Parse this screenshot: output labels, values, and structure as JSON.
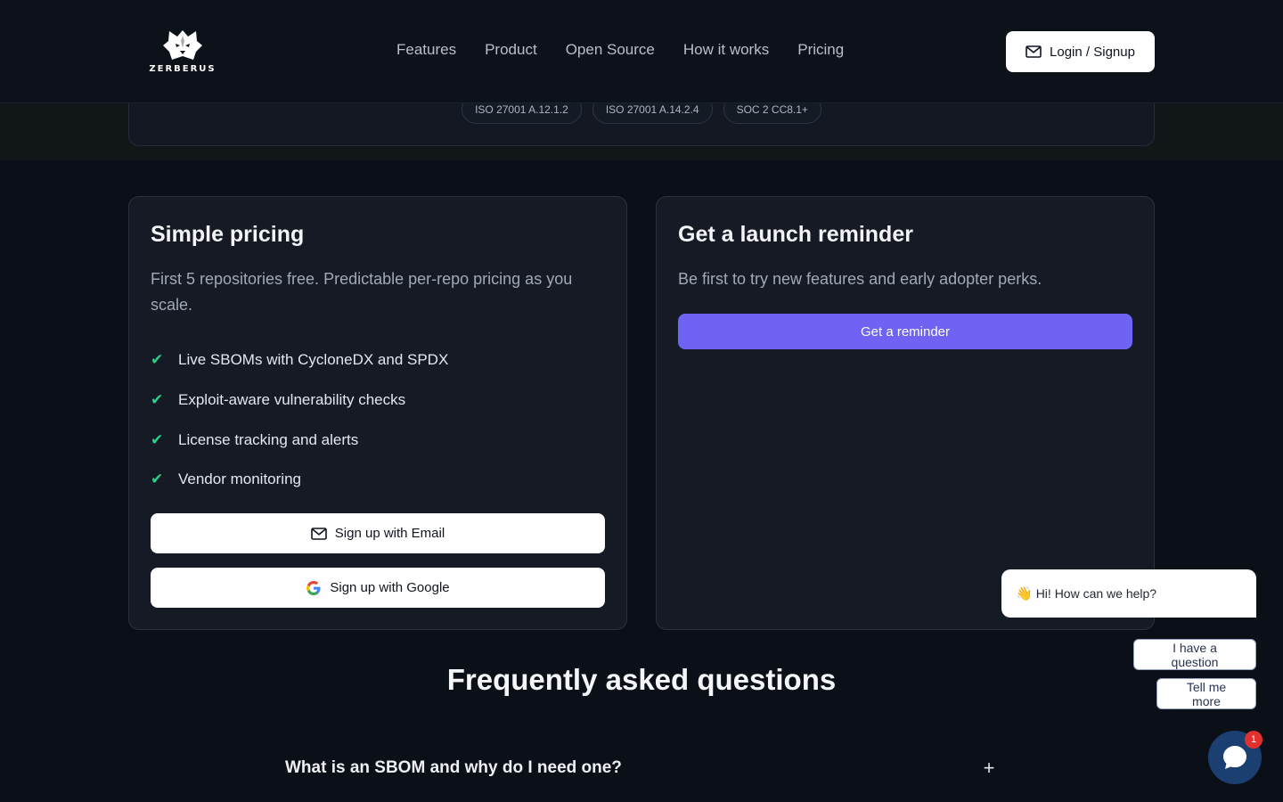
{
  "header": {
    "logo_text": "ZERBERUS",
    "nav": [
      "Features",
      "Product",
      "Open Source",
      "How it works",
      "Pricing"
    ],
    "login_label": "Login / Signup"
  },
  "compliance_chips": [
    "ISO 27001 A.12.1.2",
    "ISO 27001 A.14.2.4",
    "SOC 2 CC8.1+"
  ],
  "pricing": {
    "title": "Simple pricing",
    "description": "First 5 repositories free. Predictable per-repo pricing as you scale.",
    "features": [
      "Live SBOMs with CycloneDX and SPDX",
      "Exploit-aware vulnerability checks",
      "License tracking and alerts",
      "Vendor monitoring"
    ],
    "email_signup_label": "Sign up with Email",
    "google_signup_label": "Sign up with Google"
  },
  "reminder": {
    "title": "Get a launch reminder",
    "description": "Be first to try new features and early adopter perks.",
    "button_label": "Get a reminder"
  },
  "faq": {
    "title": "Frequently asked questions",
    "items": [
      {
        "question": "What is an SBOM and why do I need one?",
        "toggle": "+"
      }
    ]
  },
  "chat": {
    "greeting_emoji": "👋",
    "greeting": "Hi! How can we help?",
    "quick_replies": [
      "I have a question",
      "Tell me more"
    ],
    "unread_count": "1"
  },
  "colors": {
    "accent": "#6e63f2",
    "check": "#2ecf8a",
    "chat_launcher": "#1c3f72",
    "badge": "#e0312f"
  },
  "icons": {
    "logo": "wolf-head-icon",
    "login": "mail-icon",
    "email_signup": "mail-icon",
    "google_signup": "google-g-icon",
    "feature_bullet": "checkmark-icon",
    "chat": "chat-bubble-icon"
  }
}
